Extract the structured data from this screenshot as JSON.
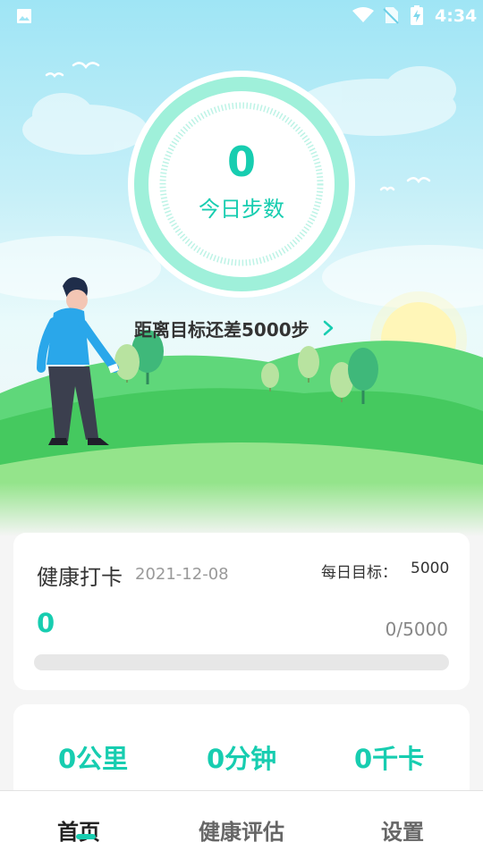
{
  "status_bar": {
    "time": "4:34",
    "icons": [
      "gallery-icon",
      "wifi-icon",
      "no-sim-icon",
      "battery-charging-icon"
    ]
  },
  "hero": {
    "step_count": "0",
    "step_label": "今日步数",
    "goal_remaining_text": "距离目标还差5000步",
    "step_progress": 0
  },
  "checkin_card": {
    "title": "健康打卡",
    "date": "2021-12-08",
    "daily_goal_label": "每日目标：",
    "daily_goal_value": "5000",
    "count": "0",
    "progress_text": "0/5000",
    "progress_fraction": 0
  },
  "stats": {
    "distance": "0公里",
    "duration": "0分钟",
    "calories": "0千卡"
  },
  "bottom_nav": {
    "items": [
      {
        "label": "首页",
        "active": true
      },
      {
        "label": "健康评估",
        "active": false
      },
      {
        "label": "设置",
        "active": false
      }
    ]
  },
  "colors": {
    "accent": "#17cdb0",
    "sky": "#9fe5f5",
    "grass": "#45c95f"
  }
}
